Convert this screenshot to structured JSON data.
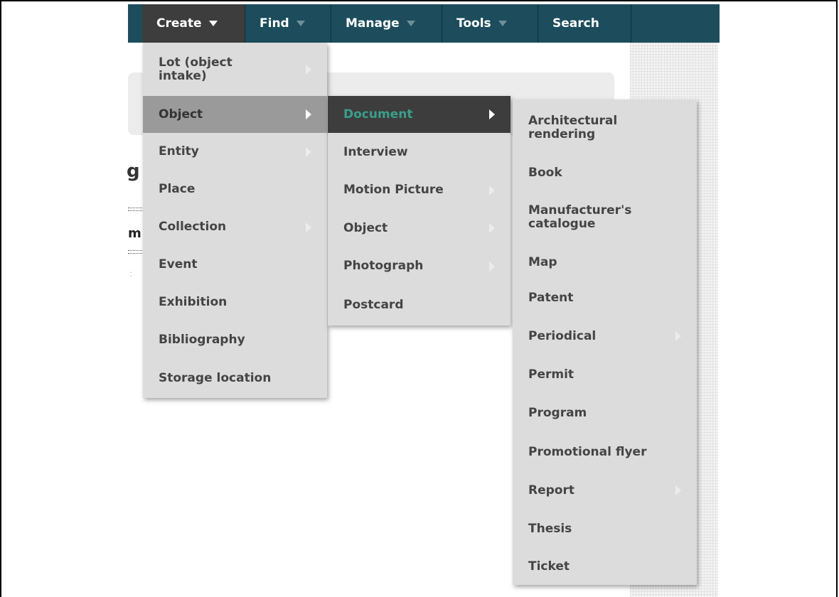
{
  "navbar": {
    "items": [
      {
        "label": "Create"
      },
      {
        "label": "Find"
      },
      {
        "label": "Manage"
      },
      {
        "label": "Tools"
      },
      {
        "label": "Search"
      }
    ]
  },
  "background": {
    "frag_g": "g",
    "frag_m": "m"
  },
  "create_menu": {
    "items": [
      {
        "label": "Lot (object intake)"
      },
      {
        "label": "Object"
      },
      {
        "label": "Entity"
      },
      {
        "label": "Place"
      },
      {
        "label": "Collection"
      },
      {
        "label": "Event"
      },
      {
        "label": "Exhibition"
      },
      {
        "label": "Bibliography"
      },
      {
        "label": "Storage location"
      }
    ]
  },
  "object_menu": {
    "items": [
      {
        "label": "Document"
      },
      {
        "label": "Interview"
      },
      {
        "label": "Motion Picture"
      },
      {
        "label": "Object"
      },
      {
        "label": "Photograph"
      },
      {
        "label": "Postcard"
      }
    ]
  },
  "document_menu": {
    "items": [
      {
        "label": "Architectural rendering"
      },
      {
        "label": "Book"
      },
      {
        "label": "Manufacturer's catalogue"
      },
      {
        "label": "Map"
      },
      {
        "label": "Patent"
      },
      {
        "label": "Periodical"
      },
      {
        "label": "Permit"
      },
      {
        "label": "Program"
      },
      {
        "label": "Promotional flyer"
      },
      {
        "label": "Report"
      },
      {
        "label": "Thesis"
      },
      {
        "label": "Ticket"
      }
    ]
  }
}
